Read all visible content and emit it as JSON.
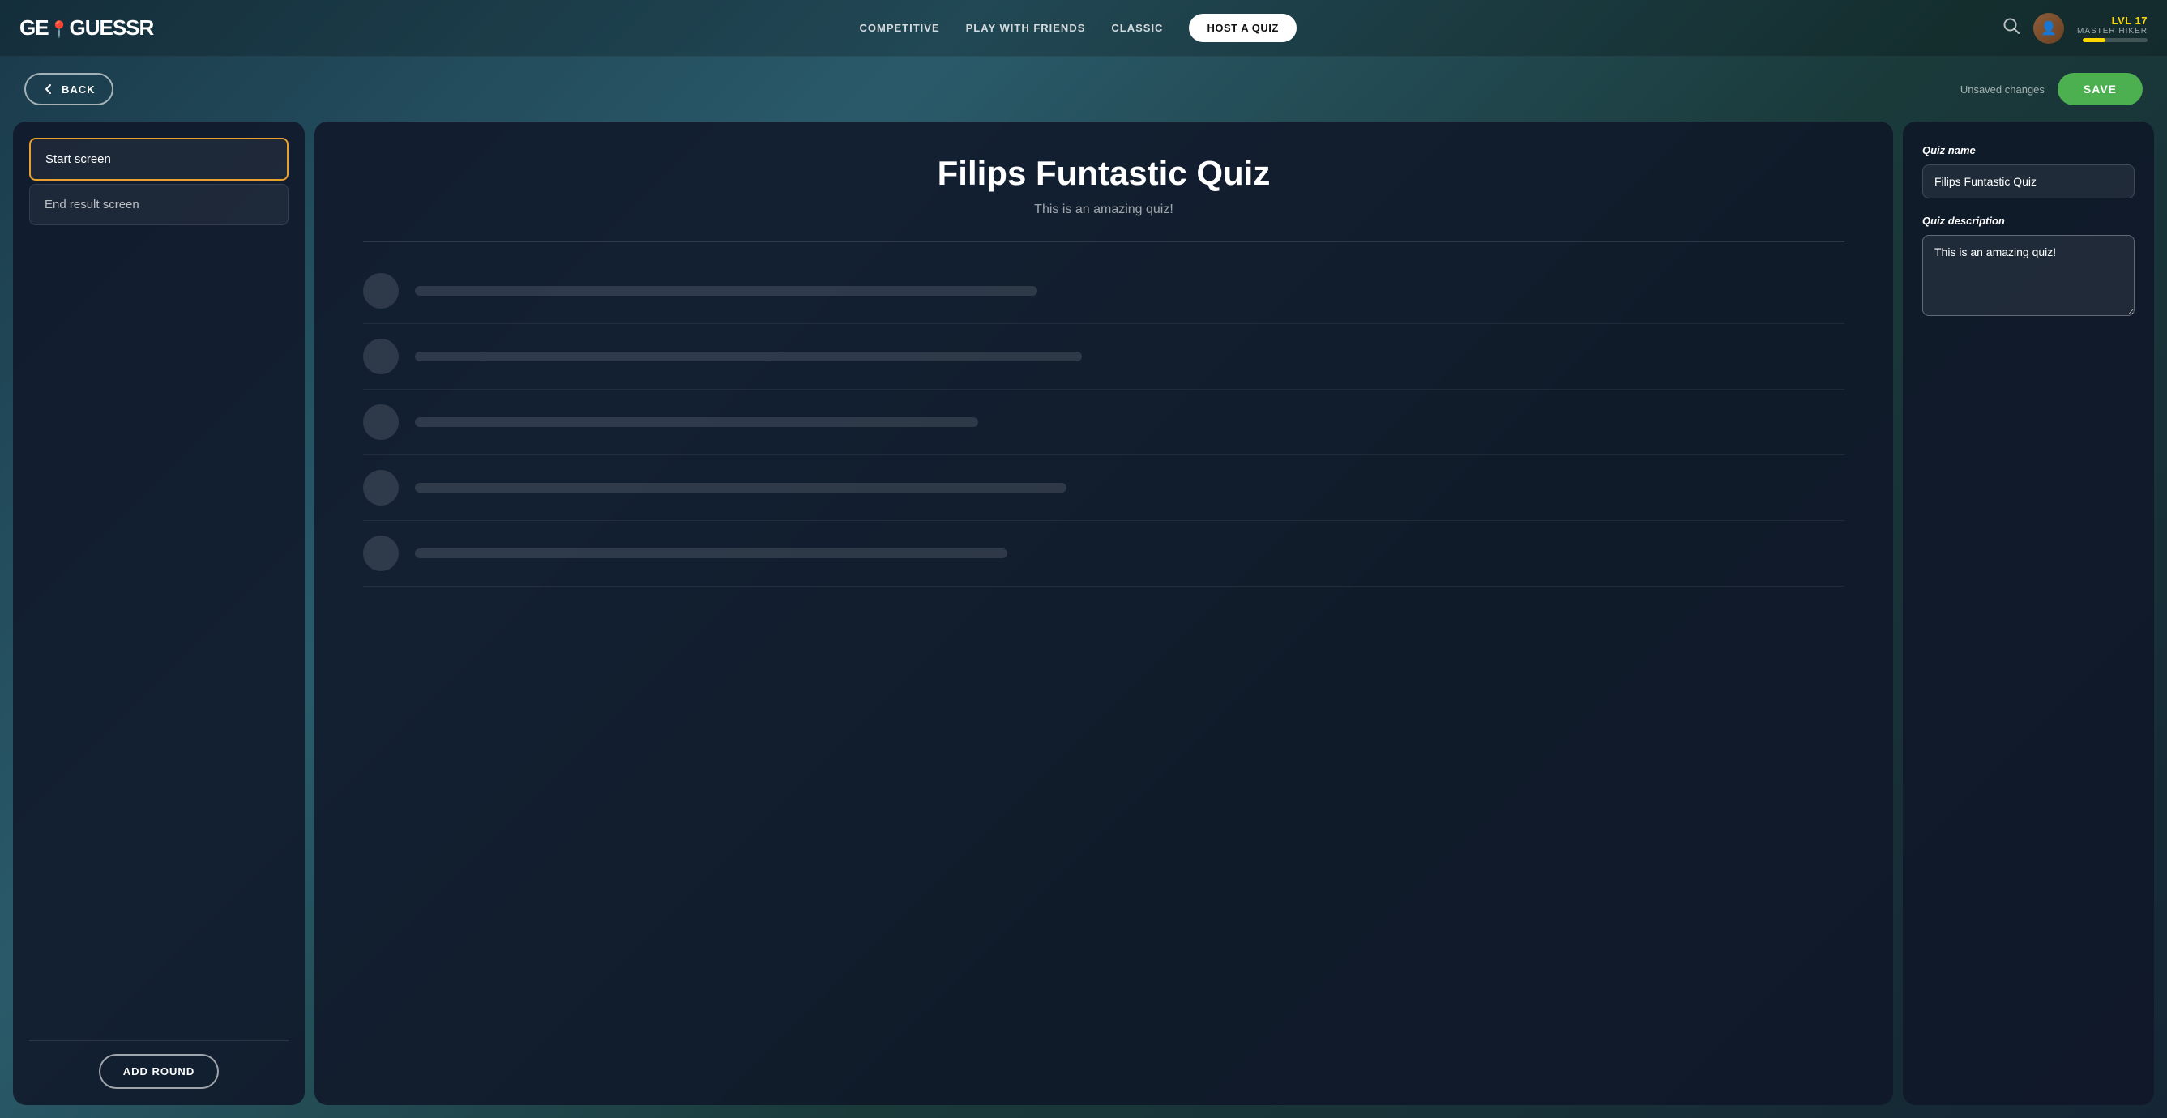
{
  "app": {
    "logo": {
      "geo": "GEO",
      "pin": "📍",
      "guessr": "GUESSR"
    }
  },
  "nav": {
    "items": [
      {
        "label": "COMPETITIVE",
        "id": "competitive"
      },
      {
        "label": "PLAY WITH FRIENDS",
        "id": "play-with-friends"
      },
      {
        "label": "CLASSIC",
        "id": "classic"
      }
    ],
    "host_label": "HOST A QUIZ"
  },
  "user": {
    "level": "LVL 17",
    "title": "MASTER HIKER",
    "xp_percent": 35
  },
  "subheader": {
    "back_label": "BACK",
    "unsaved_label": "Unsaved changes",
    "save_label": "SAVE"
  },
  "left_panel": {
    "screens": [
      {
        "label": "Start screen",
        "active": true
      },
      {
        "label": "End result screen",
        "active": false
      }
    ],
    "add_round_label": "ADD ROUND"
  },
  "center_panel": {
    "title": "Filips Funtastic Quiz",
    "subtitle": "This is an amazing quiz!",
    "rows": [
      {
        "bar_width": "42%"
      },
      {
        "bar_width": "45%"
      },
      {
        "bar_width": "38%"
      },
      {
        "bar_width": "44%"
      },
      {
        "bar_width": "40%"
      }
    ]
  },
  "right_panel": {
    "quiz_name_label": "Quiz name",
    "quiz_name_value": "Filips Funtastic Quiz",
    "quiz_name_placeholder": "Quiz name",
    "quiz_description_label": "Quiz description",
    "quiz_description_value": "This is an amazing quiz!",
    "quiz_description_placeholder": "Quiz description"
  }
}
